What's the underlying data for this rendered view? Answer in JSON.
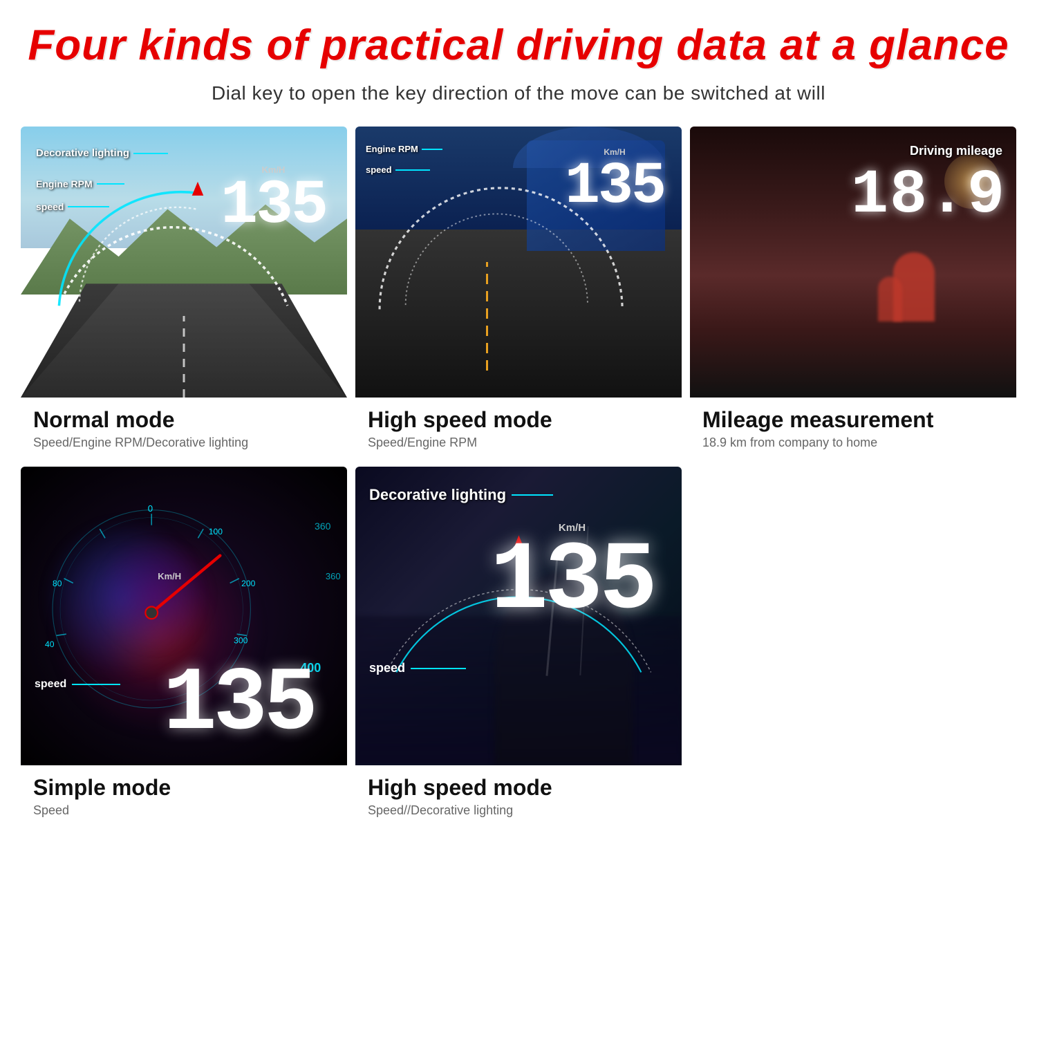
{
  "header": {
    "main_title": "Four kinds of practical driving data at a glance",
    "subtitle": "Dial key to open the key direction of the move can be switched at will"
  },
  "cards": [
    {
      "id": "normal-mode",
      "image_labels": {
        "decorative": "Decorative lighting",
        "engine": "Engine RPM",
        "speed_label": "speed",
        "kmh": "Km/H",
        "speed_value": "135"
      },
      "mode_title": "Normal mode",
      "mode_sub": "Speed/Engine RPM/Decorative lighting"
    },
    {
      "id": "high-speed-mode",
      "image_labels": {
        "engine": "Engine RPM",
        "speed_label": "speed",
        "kmh": "Km/H",
        "speed_value": "135"
      },
      "mode_title": "High speed mode",
      "mode_sub": "Speed/Engine RPM"
    },
    {
      "id": "mileage-measurement",
      "image_labels": {
        "driving": "Driving mileage",
        "mileage_value": "18.9"
      },
      "mode_title": "Mileage measurement",
      "mode_sub": "18.9 km from company to home"
    },
    {
      "id": "simple-mode",
      "image_labels": {
        "kmh": "Km/H",
        "speed_label": "speed",
        "speed_value": "135"
      },
      "mode_title": "Simple mode",
      "mode_sub": "Speed"
    },
    {
      "id": "high-speed-mode-2",
      "image_labels": {
        "decorative": "Decorative lighting",
        "speed_label": "speed",
        "kmh": "Km/H",
        "speed_value": "135"
      },
      "mode_title": "High speed mode",
      "mode_sub": "Speed//Decorative lighting"
    }
  ]
}
